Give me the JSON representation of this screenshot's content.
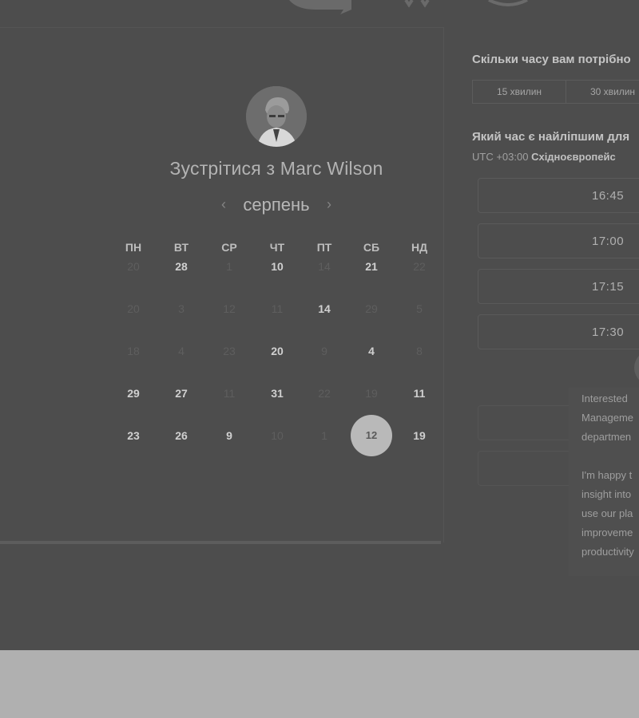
{
  "header": {
    "logo": "logo-icon"
  },
  "meeting": {
    "title": "Зустрітися з Marc Wilson",
    "month": "серпень",
    "prev_icon": "chevron-left-icon",
    "next_icon": "chevron-right-icon",
    "avatar": "avatar-photo"
  },
  "calendar": {
    "weekdays": [
      "ПН",
      "ВТ",
      "СР",
      "ЧТ",
      "ПТ",
      "СБ",
      "НД"
    ],
    "weeks": [
      [
        {
          "d": "20",
          "s": "muted"
        },
        {
          "d": "28",
          "s": "bold"
        },
        {
          "d": "1",
          "s": "muted"
        },
        {
          "d": "10",
          "s": "bold"
        },
        {
          "d": "14",
          "s": "muted"
        },
        {
          "d": "21",
          "s": "bold"
        },
        {
          "d": "22",
          "s": "muted"
        }
      ],
      [
        {
          "d": "20",
          "s": "muted"
        },
        {
          "d": "3",
          "s": "muted"
        },
        {
          "d": "12",
          "s": "muted"
        },
        {
          "d": "11",
          "s": "muted"
        },
        {
          "d": "14",
          "s": "bold"
        },
        {
          "d": "29",
          "s": "muted"
        },
        {
          "d": "5",
          "s": "muted"
        }
      ],
      [
        {
          "d": "18",
          "s": "muted"
        },
        {
          "d": "4",
          "s": "muted"
        },
        {
          "d": "23",
          "s": "muted"
        },
        {
          "d": "20",
          "s": "bold"
        },
        {
          "d": "9",
          "s": "muted"
        },
        {
          "d": "4",
          "s": "bold"
        },
        {
          "d": "8",
          "s": "muted"
        }
      ],
      [
        {
          "d": "29",
          "s": "bold"
        },
        {
          "d": "27",
          "s": "bold"
        },
        {
          "d": "11",
          "s": "muted"
        },
        {
          "d": "31",
          "s": "bold"
        },
        {
          "d": "22",
          "s": "muted"
        },
        {
          "d": "19",
          "s": "muted"
        },
        {
          "d": "11",
          "s": "bold"
        }
      ],
      [
        {
          "d": "23",
          "s": "bold"
        },
        {
          "d": "26",
          "s": "bold"
        },
        {
          "d": "9",
          "s": "bold"
        },
        {
          "d": "10",
          "s": "muted"
        },
        {
          "d": "1",
          "s": "muted"
        },
        {
          "d": "12",
          "s": "selected"
        },
        {
          "d": "19",
          "s": "bold"
        }
      ]
    ]
  },
  "duration": {
    "question": "Скільки часу вам потрібно",
    "options": [
      "15 хвилин",
      "30 хвилин"
    ]
  },
  "timeslots": {
    "question": "Який час є найліпшим для",
    "tz_offset": "UTC +03:00",
    "tz_name": "Східноєвропейс",
    "slots": [
      "16:45",
      "17:00",
      "17:15",
      "17:30"
    ]
  },
  "chat": {
    "icon": "chat-avatar-icon",
    "p1": "Interested\nManageme\ndepartmen",
    "p2": "I'm happy t\ninsight into\nuse our pla\nimproveme\nproductivity"
  },
  "colors": {
    "background": "#4d4d4d",
    "footer": "#b0b0b0",
    "selected_day": "#b9b9b9"
  }
}
